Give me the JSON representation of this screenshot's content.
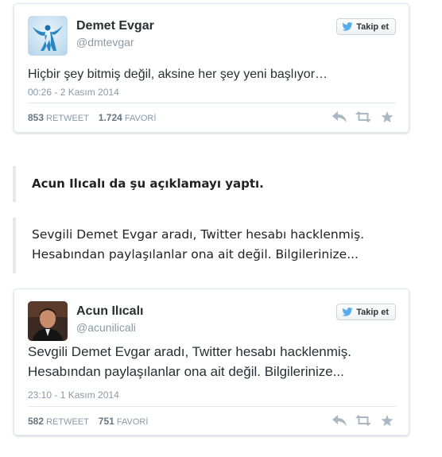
{
  "tweets": [
    {
      "name": "Demet Evgar",
      "handle": "@dmtevgar",
      "follow_label": "Takip et",
      "text": "Hiçbir şey bitmiş değil, aksine her şey yeni başlıyor…",
      "date": "00:26 - 2 Kasım 2014",
      "retweets": "853",
      "retweet_label": "RETWEET",
      "favorites": "1.724",
      "favorite_label": "FAVORİ"
    },
    {
      "name": "Acun Ilıcalı",
      "handle": "@acunilicali",
      "follow_label": "Takip et",
      "text_line1": "Sevgili Demet Evgar aradı, Twitter hesabı hacklenmiş.",
      "text_line2": "Hesabından paylaşılanlar ona ait değil. Bilgilerinize...",
      "date": "23:10 - 1 Kasım 2014",
      "retweets": "582",
      "retweet_label": "RETWEET",
      "favorites": "751",
      "favorite_label": "FAVORİ"
    }
  ],
  "article": {
    "quote_heading": "Acun Ilıcalı da şu açıklamayı yaptı.",
    "quote_line1": "Sevgili Demet Evgar aradı, Twitter hesabı hacklenmiş.",
    "quote_line2": "Hesabından paylaşılanlar ona ait değil. Bilgilerinize..."
  },
  "icons": [
    "twitter-bird-icon",
    "reply-icon",
    "retweet-icon",
    "favorite-star-icon"
  ],
  "colors": {
    "text": "#292f33",
    "muted": "#8899a6",
    "bird": "#55acee",
    "action": "#aab8c2"
  }
}
